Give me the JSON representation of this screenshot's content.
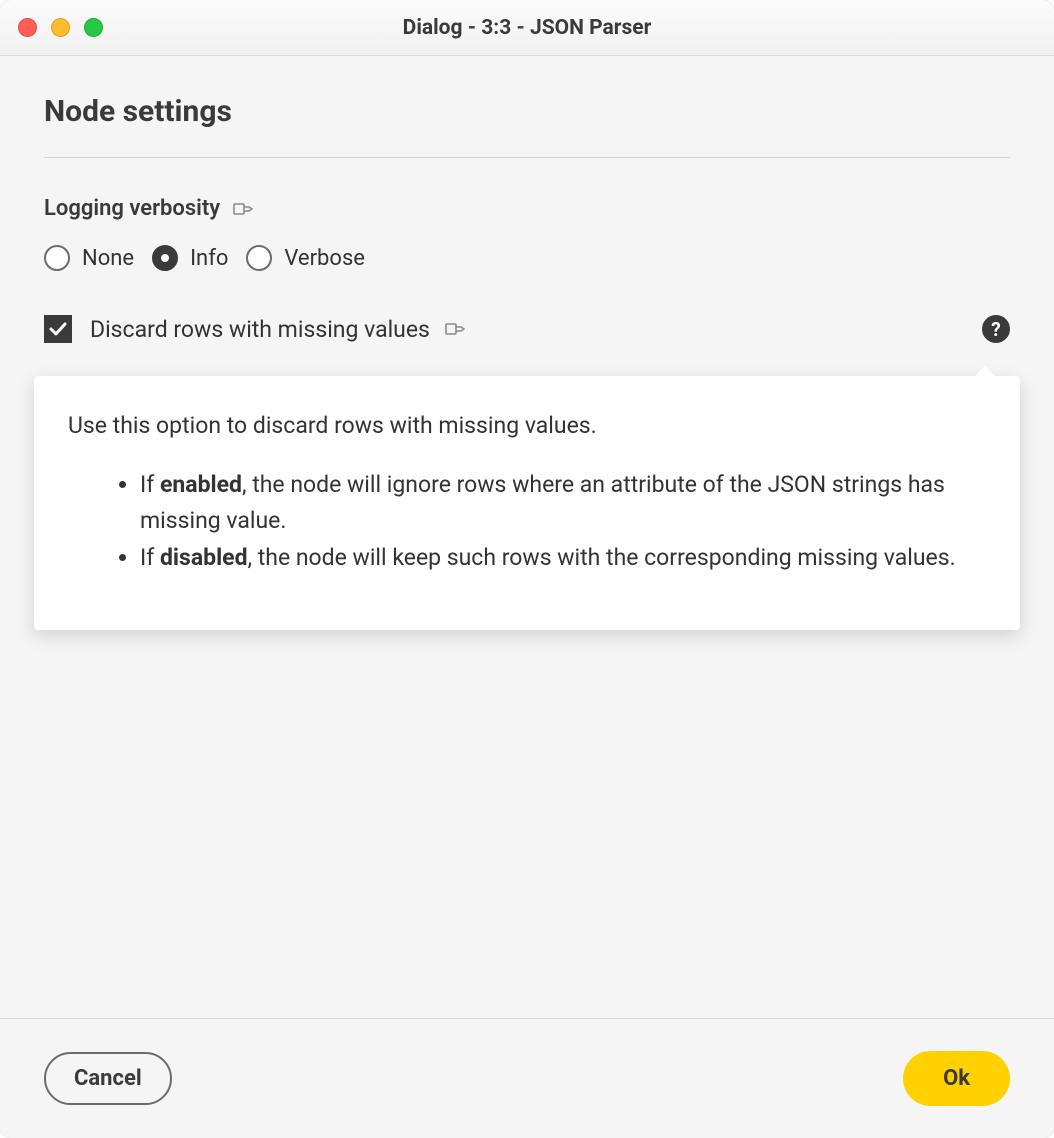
{
  "window": {
    "title": "Dialog - 3:3 - JSON Parser"
  },
  "section": {
    "heading": "Node settings"
  },
  "logging": {
    "label": "Logging verbosity",
    "options": [
      {
        "label": "None",
        "selected": false
      },
      {
        "label": "Info",
        "selected": true
      },
      {
        "label": "Verbose",
        "selected": false
      }
    ]
  },
  "discard": {
    "label": "Discard rows with missing values",
    "checked": true,
    "help": {
      "intro": "Use this option to discard rows with missing values.",
      "bullets": [
        {
          "lead": "If ",
          "strong": "enabled",
          "tail": ", the node will ignore rows where an attribute of the JSON strings has missing value."
        },
        {
          "lead": "If ",
          "strong": "disabled",
          "tail": ", the node will keep such rows with the corresponding missing values."
        }
      ]
    }
  },
  "footer": {
    "cancel": "Cancel",
    "ok": "Ok"
  }
}
